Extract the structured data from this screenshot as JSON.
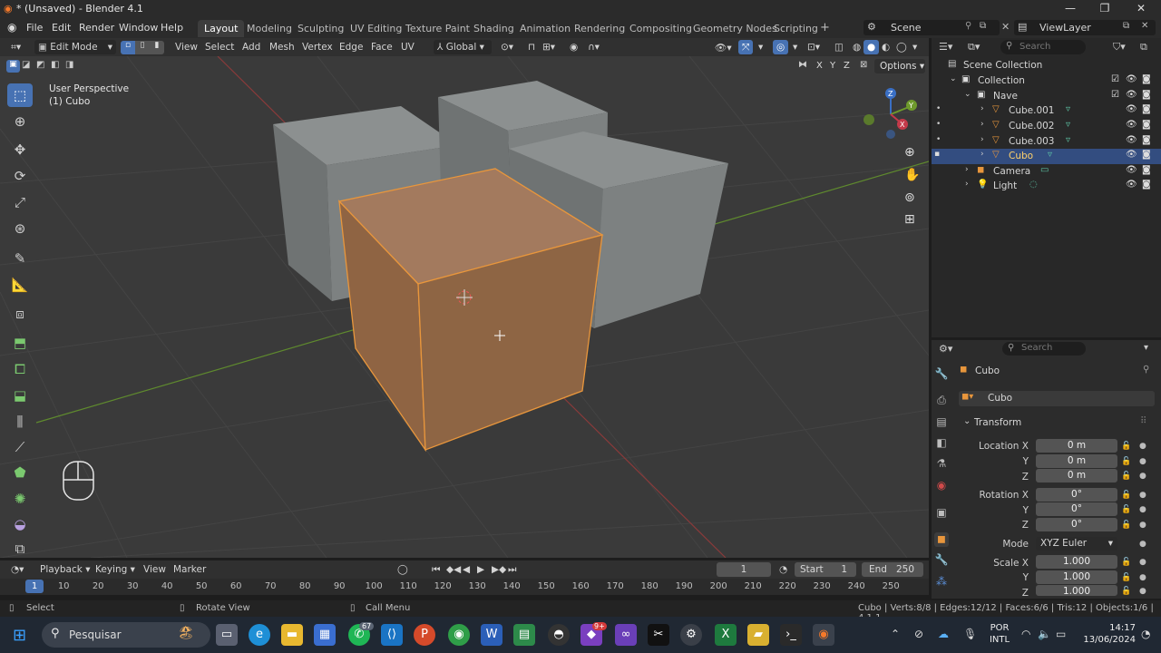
{
  "window": {
    "title": "* (Unsaved) - Blender 4.1"
  },
  "menus": [
    "File",
    "Edit",
    "Render",
    "Window",
    "Help"
  ],
  "workspaces": [
    "Layout",
    "Modeling",
    "Sculpting",
    "UV Editing",
    "Texture Paint",
    "Shading",
    "Animation",
    "Rendering",
    "Compositing",
    "Geometry Nodes",
    "Scripting"
  ],
  "scene": {
    "name": "Scene",
    "view_layer": "ViewLayer"
  },
  "viewport_header": {
    "mode": "Edit Mode",
    "menus": [
      "View",
      "Select",
      "Add",
      "Mesh",
      "Vertex",
      "Edge",
      "Face",
      "UV"
    ],
    "orientation": "Global",
    "options": "Options",
    "axes": [
      "X",
      "Y",
      "Z"
    ]
  },
  "viewport": {
    "perspective": "User Perspective",
    "object": "(1) Cubo",
    "gizmo": {
      "z": "Z",
      "y": "Y",
      "x": "X"
    }
  },
  "outliner": {
    "search_placeholder": "Search",
    "root": "Scene Collection",
    "items": [
      {
        "label": "Collection"
      },
      {
        "label": "Nave"
      },
      {
        "label": "Cube.001"
      },
      {
        "label": "Cube.002"
      },
      {
        "label": "Cube.003"
      },
      {
        "label": "Cubo"
      },
      {
        "label": "Camera"
      },
      {
        "label": "Light"
      }
    ]
  },
  "properties": {
    "search_placeholder": "Search",
    "object_name": "Cubo",
    "data_name": "Cubo",
    "panel": "Transform",
    "location": {
      "label": "Location X",
      "x": "0 m",
      "y": "0 m",
      "z": "0 m"
    },
    "rotation": {
      "label": "Rotation X",
      "x": "0°",
      "y": "0°",
      "z": "0°"
    },
    "mode": {
      "label": "Mode",
      "value": "XYZ Euler"
    },
    "scale": {
      "label": "Scale X",
      "x": "1.000",
      "y": "1.000",
      "z": "1.000"
    },
    "axis_y": "Y",
    "axis_z": "Z"
  },
  "timeline": {
    "menus": [
      "Playback",
      "Keying",
      "View",
      "Marker"
    ],
    "current_frame": "1",
    "start_label": "Start",
    "start": "1",
    "end_label": "End",
    "end": "250",
    "ticks": [
      "1",
      "10",
      "20",
      "30",
      "40",
      "50",
      "60",
      "70",
      "80",
      "90",
      "100",
      "110",
      "120",
      "130",
      "140",
      "150",
      "160",
      "170",
      "180",
      "190",
      "200",
      "210",
      "220",
      "230",
      "240",
      "250"
    ]
  },
  "statusbar": {
    "select": "Select",
    "rotate": "Rotate View",
    "call_menu": "Call Menu",
    "stats": "Cubo | Verts:8/8 | Edges:12/12 | Faces:6/6 | Tris:12 | Objects:1/6 | 4.1.1"
  },
  "taskbar": {
    "search_placeholder": "Pesquisar",
    "whatsapp_badge": "67",
    "notif_badge": "9+",
    "lang": "POR",
    "layout": "INTL",
    "time": "14:17",
    "date": "13/06/2024"
  },
  "colors": {
    "accent": "#4772b3",
    "selection_orange": "#e8963c",
    "viewport_bg": "#3a3a3a",
    "selected_row": "#334d80"
  }
}
